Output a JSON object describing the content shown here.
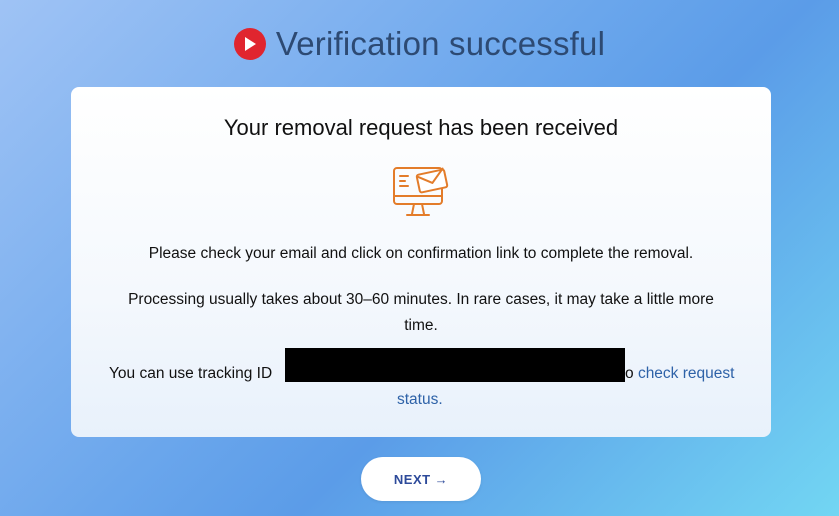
{
  "header": {
    "title": "Verification successful",
    "logo_icon": "play-circle-icon",
    "logo_color": "#e0252f"
  },
  "card": {
    "title": "Your removal request has been received",
    "illustration_icon": "monitor-mail-icon",
    "illustration_color": "#e37c2a",
    "message_email": "Please check your email and click on confirmation link to complete the removal.",
    "message_processing": "Processing usually takes about 30–60 minutes. In rare cases, it may take a little more time.",
    "tracking_label": "You can use tracking ID",
    "tracking_suffix_prefix": "o",
    "tracking_link_part1": "check request",
    "tracking_link_part2": "status."
  },
  "actions": {
    "next_label": "NEXT",
    "next_arrow": "→"
  },
  "colors": {
    "title_text": "#2d4a73",
    "link": "#2e62a8",
    "button_text": "#2d4a9a"
  }
}
